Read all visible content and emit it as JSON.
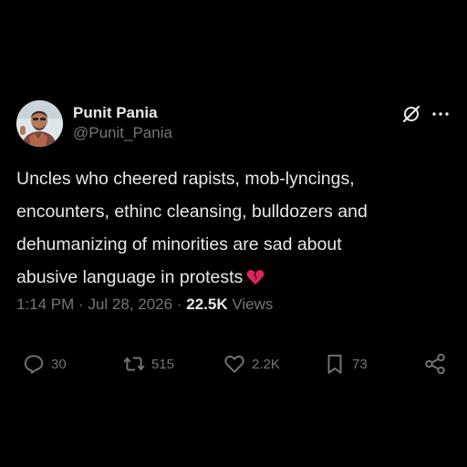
{
  "author": {
    "display_name": "Punit Pania",
    "handle": "@Punit_Pania"
  },
  "post": {
    "text": "Uncles who cheered rapists, mob-lyncings,\nencounters, ethinc cleansing, bulldozers and\ndehumanizing of minorities are sad about\nabusive language in protests",
    "emoji": "broken-heart-icon"
  },
  "meta": {
    "time": "1:14 PM",
    "separator": "·",
    "date": "Jul 28, 2026",
    "views_count": "22.5K",
    "views_label": "Views"
  },
  "actions": {
    "replies": "30",
    "reposts": "515",
    "likes": "2.2K",
    "bookmarks": "73"
  },
  "icons": [
    "grok-icon",
    "more-icon",
    "reply-icon",
    "repost-icon",
    "like-icon",
    "bookmark-icon",
    "share-icon"
  ],
  "colors": {
    "background": "#000000",
    "text": "#e7e9ea",
    "muted": "#71767b",
    "heart": "#e0245e"
  }
}
